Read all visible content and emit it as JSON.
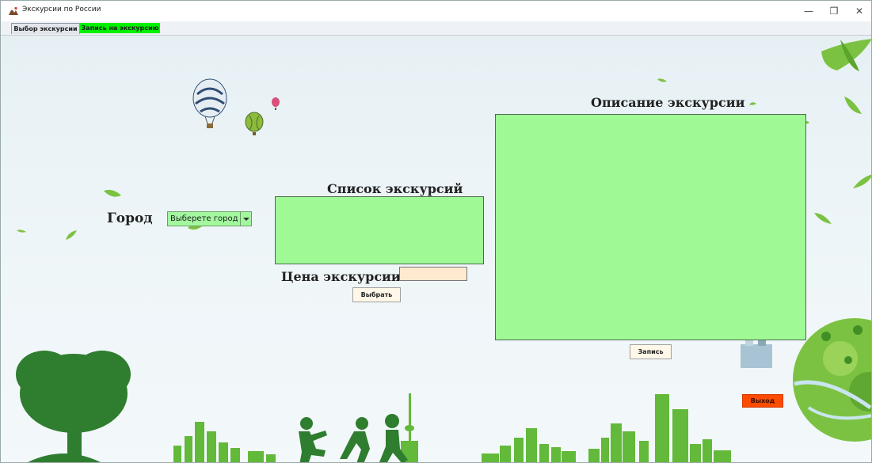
{
  "window": {
    "title": "Экскурсии по России",
    "controls": {
      "minimize": "—",
      "maximize": "❐",
      "close": "✕"
    }
  },
  "tabs": [
    {
      "label": "Выбор экскурсии",
      "selected": true
    },
    {
      "label": "Запись на экскурсию",
      "selected": false
    }
  ],
  "labels": {
    "city": "Город",
    "excursion_list": "Список экскурсий",
    "price": "Цена экскурсии",
    "description": "Описание экскурсии"
  },
  "city_select": {
    "value": "Выберете город"
  },
  "buttons": {
    "select": "Выбрать",
    "record": "Запись",
    "exit": "Выход"
  },
  "colors": {
    "field_green": "#9ffa95",
    "tab_active_green": "#00f000",
    "price_field": "#ffe9cf",
    "exit_button": "#ff4b00",
    "silhouette_green": "#62b93a"
  },
  "decorations": {
    "icons": [
      "hot-air-balloon-icon",
      "leaf-icon",
      "tree-icon",
      "city-skyline-icon",
      "children-running-icon",
      "globe-landscape-icon"
    ]
  }
}
